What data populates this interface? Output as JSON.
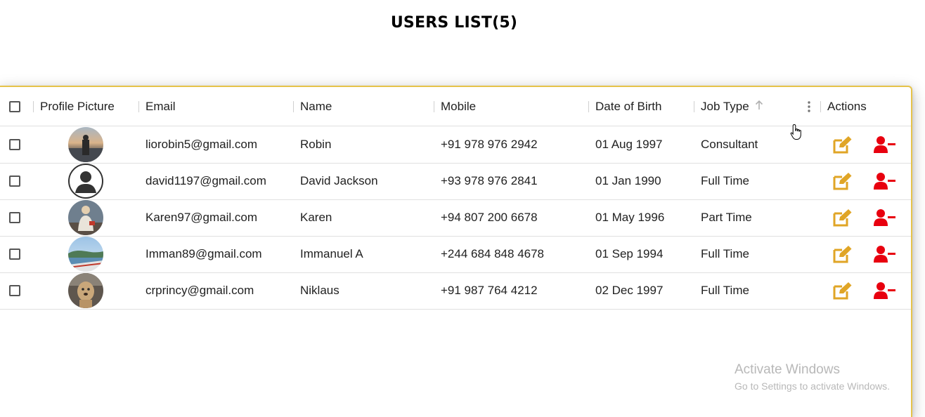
{
  "page": {
    "title": "USERS LIST(5)"
  },
  "table": {
    "columns": {
      "profile_picture": "Profile Picture",
      "email": "Email",
      "name": "Name",
      "mobile": "Mobile",
      "date_of_birth": "Date of Birth",
      "job_type": "Job Type",
      "actions": "Actions"
    },
    "sort": {
      "column": "Job Type",
      "direction": "ascending",
      "icon": "arrow-up-icon"
    },
    "rows": [
      {
        "email": "liorobin5@gmail.com",
        "name": "Robin",
        "mobile": "+91 978 976 2942",
        "dob": "01 Aug 1997",
        "job_type": "Consultant",
        "avatar": "photo-sunset"
      },
      {
        "email": "david1197@gmail.com",
        "name": "David Jackson",
        "mobile": "+93 978 976 2841",
        "dob": "01 Jan 1990",
        "job_type": "Full Time",
        "avatar": "default-user"
      },
      {
        "email": "Karen97@gmail.com",
        "name": "Karen",
        "mobile": "+94 807 200 6678",
        "dob": "01 May 1996",
        "job_type": "Part Time",
        "avatar": "photo-person"
      },
      {
        "email": "Imman89@gmail.com",
        "name": "Immanuel A",
        "mobile": "+244 684 848 4678",
        "dob": "01 Sep 1994",
        "job_type": "Full Time",
        "avatar": "photo-beach"
      },
      {
        "email": "crprincy@gmail.com",
        "name": "Niklaus",
        "mobile": "+91 987 764 4212",
        "dob": "02 Dec 1997",
        "job_type": "Full Time",
        "avatar": "photo-dog"
      }
    ]
  },
  "actions": {
    "edit_icon": "edit-icon",
    "remove_icon": "remove-user-icon"
  },
  "colors": {
    "edit": "#e0a526",
    "remove": "#e8000f",
    "grid_border": "#e6c34a"
  },
  "watermark": {
    "line1": "Activate Windows",
    "line2": "Go to Settings to activate Windows."
  }
}
